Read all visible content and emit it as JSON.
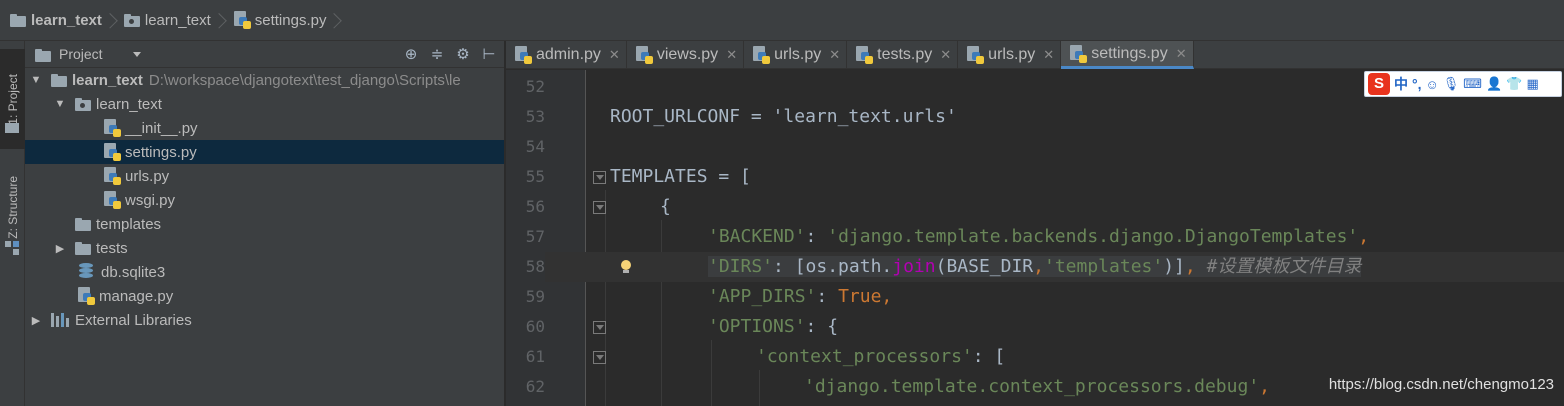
{
  "breadcrumb": {
    "items": [
      "learn_text",
      "learn_text",
      "settings.py"
    ]
  },
  "toolstrip": {
    "project_tab": "1: Project",
    "structure_tab": "Z: Structure"
  },
  "project_panel": {
    "title": "Project",
    "toolbar_icons": [
      "target-icon",
      "collapse-icon",
      "gear-icon",
      "pin-icon"
    ],
    "root": {
      "name": "learn_text",
      "path": "D:\\workspace\\djangotext\\test_django\\Scripts\\le"
    },
    "tree": [
      {
        "label": "learn_text",
        "kind": "folder",
        "level": 1,
        "expanded": true
      },
      {
        "label": "__init__.py",
        "kind": "py",
        "level": 2
      },
      {
        "label": "settings.py",
        "kind": "py",
        "level": 2,
        "selected": true
      },
      {
        "label": "urls.py",
        "kind": "py",
        "level": 2
      },
      {
        "label": "wsgi.py",
        "kind": "py",
        "level": 2
      },
      {
        "label": "templates",
        "kind": "folder",
        "level": 1
      },
      {
        "label": "tests",
        "kind": "folder",
        "level": 1,
        "collapsed": true
      },
      {
        "label": "db.sqlite3",
        "kind": "db",
        "level": 1
      },
      {
        "label": "manage.py",
        "kind": "py",
        "level": 1
      }
    ],
    "external": "External Libraries"
  },
  "tabs": [
    {
      "label": "admin.py",
      "active": false
    },
    {
      "label": "views.py",
      "active": false
    },
    {
      "label": "urls.py",
      "active": false
    },
    {
      "label": "tests.py",
      "active": false
    },
    {
      "label": "urls.py",
      "active": false
    },
    {
      "label": "settings.py",
      "active": true
    }
  ],
  "tab_close": "✕",
  "editor": {
    "line_numbers": [
      "52",
      "53",
      "54",
      "55",
      "56",
      "57",
      "58",
      "59",
      "60",
      "61",
      "62"
    ],
    "caret_line": "58",
    "code": {
      "l53": "ROOT_URLCONF = 'learn_text.urls'",
      "l55_a": "TEMPLATES = [",
      "l56": "{",
      "l57_key": "'BACKEND'",
      "l57_colon": ": ",
      "l57_val": "'django.template.backends.django.DjangoTemplates'",
      "l57_comma": ",",
      "l58_key": "'DIRS'",
      "l58_a": ": [os.path.",
      "l58_fn": "join",
      "l58_b": "(BASE_DIR",
      "l58_c": ",",
      "l58_val": "'templates'",
      "l58_d": ")]",
      "l58_comma": ", ",
      "l58_comment": "#设置模板文件目录",
      "l59_key": "'APP_DIRS'",
      "l59_colon": ": ",
      "l59_val": "True",
      "l59_comma": ",",
      "l60_key": "'OPTIONS'",
      "l60_rest": ": {",
      "l61_key": "'context_processors'",
      "l61_rest": ": [",
      "l62_val": "'django.template.context_processors.debug'",
      "l62_comma": ","
    }
  },
  "ime": {
    "logo": "S",
    "mode": "中",
    "punct": "°,",
    "icons": [
      "smiley-icon",
      "mic-icon",
      "keyboard-icon",
      "user-icon",
      "shirt-icon",
      "grid-icon"
    ]
  },
  "watermark": "https://blog.csdn.net/chengmo123"
}
